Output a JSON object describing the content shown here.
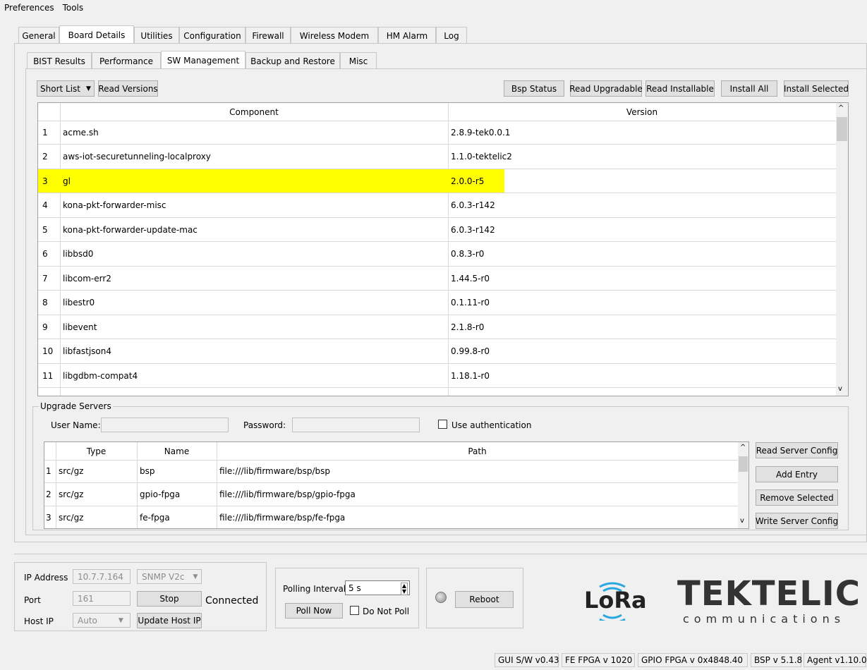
{
  "menu": [
    "Preferences",
    "Tools"
  ],
  "main_tabs": [
    "General",
    "Board Details",
    "Utilities",
    "Configuration",
    "Firewall",
    "Wireless Modem",
    "HM Alarm",
    "Log"
  ],
  "sub_tabs": [
    "BIST Results",
    "Performance",
    "SW Management",
    "Backup and Restore",
    "Misc"
  ],
  "toolbar": {
    "short_list": "Short List",
    "read_versions": "Read Versions",
    "bsp_status": "Bsp Status",
    "read_upgradable": "Read Upgradable",
    "read_installable": "Read Installable",
    "install_all": "Install All",
    "install_selected": "Install Selected"
  },
  "components": {
    "col_component": "Component",
    "col_version": "Version",
    "rows": [
      {
        "n": "1",
        "name": "acme.sh",
        "version": "2.8.9-tek0.0.1"
      },
      {
        "n": "2",
        "name": "aws-iot-securetunneling-localproxy",
        "version": "1.1.0-tektelic2"
      },
      {
        "n": "3",
        "name": "gl",
        "version": "2.0.0-r5"
      },
      {
        "n": "4",
        "name": "kona-pkt-forwarder-misc",
        "version": "6.0.3-r142"
      },
      {
        "n": "5",
        "name": "kona-pkt-forwarder-update-mac",
        "version": "6.0.3-r142"
      },
      {
        "n": "6",
        "name": "libbsd0",
        "version": "0.8.3-r0"
      },
      {
        "n": "7",
        "name": "libcom-err2",
        "version": "1.44.5-r0"
      },
      {
        "n": "8",
        "name": "libestr0",
        "version": "0.1.11-r0"
      },
      {
        "n": "9",
        "name": "libevent",
        "version": "2.1.8-r0"
      },
      {
        "n": "10",
        "name": "libfastjson4",
        "version": "0.99.8-r0"
      },
      {
        "n": "11",
        "name": "libgdbm-compat4",
        "version": "1.18.1-r0"
      }
    ],
    "highlight_color": "#ffff00"
  },
  "upgrade": {
    "title": "Upgrade Servers",
    "user_label": "User Name:",
    "password_label": "Password:",
    "use_auth": "Use authentication",
    "col_type": "Type",
    "col_name": "Name",
    "col_path": "Path",
    "rows": [
      {
        "n": "1",
        "type": "src/gz",
        "name": "bsp",
        "path": "file:///lib/firmware/bsp/bsp"
      },
      {
        "n": "2",
        "type": "src/gz",
        "name": "gpio-fpga",
        "path": "file:///lib/firmware/bsp/gpio-fpga"
      },
      {
        "n": "3",
        "type": "src/gz",
        "name": "fe-fpga",
        "path": "file:///lib/firmware/bsp/fe-fpga"
      }
    ],
    "read_server_config": "Read Server Config",
    "add_entry": "Add Entry",
    "remove_selected": "Remove Selected",
    "write_server_config": "Write Server Config"
  },
  "connection": {
    "ip_label": "IP Address",
    "ip_value": "10.7.7.164",
    "snmp": "SNMP V2c",
    "port_label": "Port",
    "port_value": "161",
    "stop": "Stop",
    "status": "Connected",
    "host_label": "Host IP",
    "host_value": "Auto",
    "update_host": "Update Host IP"
  },
  "polling": {
    "label": "Polling Interval:",
    "value": "5 s",
    "poll_now": "Poll Now",
    "do_not_poll": "Do Not Poll"
  },
  "reboot": "Reboot",
  "logos": {
    "lora": "LoRa",
    "tektelic": "TEKTELIC",
    "communications": "communications"
  },
  "status_bar": [
    "GUI S/W v0.43",
    "FE FPGA v 1020",
    "GPIO FPGA v 0x4848.40",
    "BSP v 5.1.8",
    "Agent v1.10.0"
  ]
}
